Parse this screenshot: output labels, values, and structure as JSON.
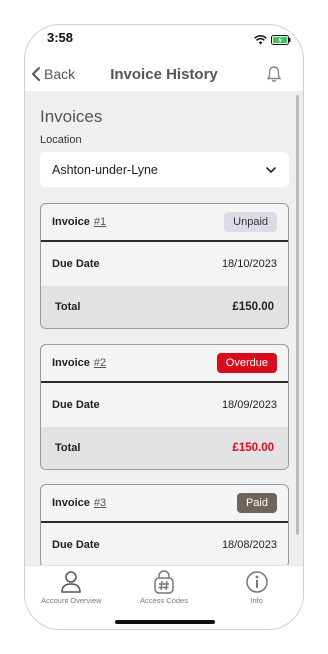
{
  "status_bar": {
    "time": "3:58"
  },
  "header": {
    "back_label": "Back",
    "title": "Invoice History"
  },
  "page": {
    "heading": "Invoices",
    "location_label": "Location",
    "location_value": "Ashton-under-Lyne"
  },
  "invoices": [
    {
      "label": "Invoice",
      "number": "#1",
      "status": "Unpaid",
      "due_label": "Due Date",
      "due_date": "18/10/2023",
      "total_label": "Total",
      "total": "£150.00"
    },
    {
      "label": "Invoice",
      "number": "#2",
      "status": "Overdue",
      "due_label": "Due Date",
      "due_date": "18/09/2023",
      "total_label": "Total",
      "total": "£150.00"
    },
    {
      "label": "Invoice",
      "number": "#3",
      "status": "Paid",
      "due_label": "Due Date",
      "due_date": "18/08/2023"
    }
  ],
  "tabs": [
    {
      "label": "Account Overview",
      "icon": "person-icon"
    },
    {
      "label": "Access Codes",
      "icon": "keypad-icon"
    },
    {
      "label": "Info",
      "icon": "info-icon"
    }
  ],
  "colors": {
    "overdue": "#d90b1c",
    "paid": "#6e635d",
    "unpaid": "#dedbe6"
  }
}
